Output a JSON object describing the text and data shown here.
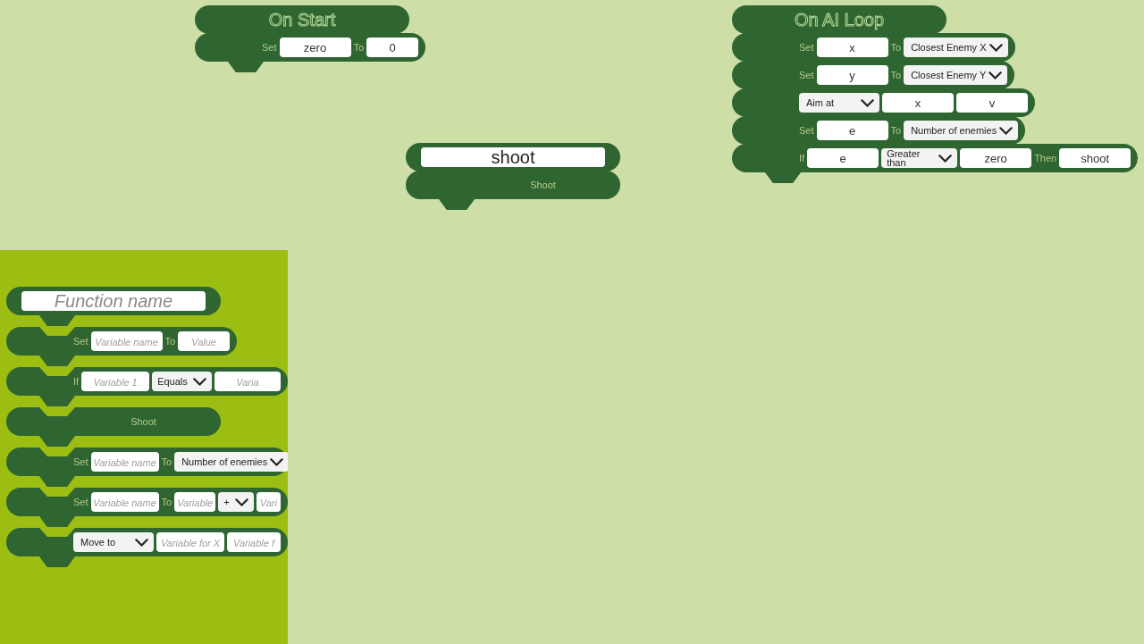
{
  "workspace": {
    "scripts": [
      {
        "blocks": [
          {
            "kind": "hat",
            "parts": [
              {
                "kind": "title",
                "text": "On Start"
              }
            ]
          },
          {
            "kind": "statement",
            "parts": [
              {
                "kind": "label",
                "text": "Set"
              },
              {
                "kind": "input",
                "value": "zero"
              },
              {
                "kind": "label",
                "text": "To"
              },
              {
                "kind": "short_input",
                "value": "0"
              }
            ]
          }
        ]
      },
      {
        "blocks": [
          {
            "kind": "hat",
            "parts": [
              {
                "kind": "title",
                "text": "On AI Loop"
              }
            ]
          },
          {
            "kind": "statement",
            "parts": [
              {
                "kind": "label",
                "text": "Set"
              },
              {
                "kind": "input",
                "value": "x"
              },
              {
                "kind": "label",
                "text": "To"
              },
              {
                "kind": "menu",
                "value": "Closest Enemy X"
              }
            ]
          },
          {
            "kind": "statement",
            "parts": [
              {
                "kind": "label",
                "text": "Set"
              },
              {
                "kind": "input",
                "value": "y"
              },
              {
                "kind": "label",
                "text": "To"
              },
              {
                "kind": "menu",
                "value": "Closest Enemy Y"
              }
            ]
          },
          {
            "kind": "statement",
            "parts": [
              {
                "kind": "menu",
                "value": "Aim at"
              },
              {
                "kind": "input",
                "value": "x"
              },
              {
                "kind": "input",
                "value": "v"
              }
            ]
          },
          {
            "kind": "statement",
            "parts": [
              {
                "kind": "label",
                "text": "Set"
              },
              {
                "kind": "input",
                "value": "e"
              },
              {
                "kind": "label",
                "text": "To"
              },
              {
                "kind": "menu",
                "value": "Number of enemies"
              }
            ]
          },
          {
            "kind": "statement",
            "parts": [
              {
                "kind": "label",
                "text": "If"
              },
              {
                "kind": "input",
                "value": "e"
              },
              {
                "kind": "operator",
                "value": "Greater than"
              },
              {
                "kind": "input",
                "value": "zero"
              },
              {
                "kind": "label",
                "text": "Then"
              },
              {
                "kind": "input",
                "value": "shoot"
              }
            ]
          }
        ]
      },
      {
        "blocks": [
          {
            "kind": "hat",
            "parts": [
              {
                "kind": "name_input",
                "value": "shoot"
              }
            ]
          },
          {
            "kind": "call",
            "parts": [
              {
                "kind": "label",
                "text": "Shoot"
              }
            ]
          }
        ]
      }
    ]
  },
  "palette": {
    "blocks": [
      {
        "kind": "hat",
        "parts": [
          {
            "kind": "name_input",
            "placeholder": "Function name"
          }
        ]
      },
      {
        "kind": "statement",
        "parts": [
          {
            "kind": "label",
            "text": "Set"
          },
          {
            "kind": "input",
            "placeholder": "Variable name"
          },
          {
            "kind": "label",
            "text": "To"
          },
          {
            "kind": "short_input",
            "placeholder": "Value"
          }
        ]
      },
      {
        "kind": "statement",
        "parts": [
          {
            "kind": "label",
            "text": "If"
          },
          {
            "kind": "input",
            "placeholder": "Variable 1"
          },
          {
            "kind": "operator",
            "value": "Equals"
          },
          {
            "kind": "input",
            "placeholder": "Varia"
          }
        ]
      },
      {
        "kind": "call",
        "parts": [
          {
            "kind": "label",
            "text": "Shoot"
          }
        ]
      },
      {
        "kind": "statement",
        "parts": [
          {
            "kind": "label",
            "text": "Set"
          },
          {
            "kind": "input",
            "placeholder": "Variable name"
          },
          {
            "kind": "label",
            "text": "To"
          },
          {
            "kind": "menu",
            "value": "Number of enemies"
          }
        ]
      },
      {
        "kind": "statement",
        "parts": [
          {
            "kind": "label",
            "text": "Set"
          },
          {
            "kind": "input",
            "placeholder": "Variable name"
          },
          {
            "kind": "label",
            "text": "To"
          },
          {
            "kind": "short_input",
            "placeholder": "Variable"
          },
          {
            "kind": "operator",
            "value": "+"
          },
          {
            "kind": "input",
            "placeholder": "Vari"
          }
        ]
      },
      {
        "kind": "statement",
        "parts": [
          {
            "kind": "menu",
            "value": "Move to"
          },
          {
            "kind": "input",
            "placeholder": "Variable for X"
          },
          {
            "kind": "input",
            "placeholder": "Variable f"
          }
        ]
      }
    ]
  }
}
